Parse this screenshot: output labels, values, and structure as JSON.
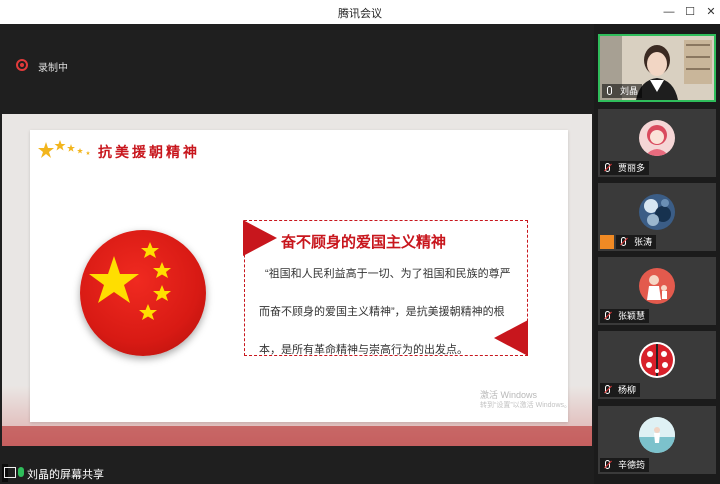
{
  "window": {
    "title": "腾讯会议",
    "minimize": "—",
    "maximize": "☐",
    "close": "✕"
  },
  "recording": {
    "label": "录制中"
  },
  "slide": {
    "heading": "抗美援朝精神",
    "quote_title": "奋不顾身的爱国主义精神",
    "quote_lines": [
      "“祖国和人民利益高于一切、为了祖国和民族的尊严",
      "而奋不顾身的爱国主义精神”，是抗美援朝精神的根",
      "本，是所有革命精神与崇高行为的出发点。"
    ],
    "watermark_line1": "激活 Windows",
    "watermark_line2": "转到“设置”以激活 Windows。"
  },
  "share": {
    "label": "刘晶的屏幕共享"
  },
  "participants": [
    {
      "name": "刘晶",
      "active": true,
      "mic": "on",
      "icon": "camera-video"
    },
    {
      "name": "贾丽多",
      "active": false,
      "mic": "muted",
      "icon": "avatar-girl-pink"
    },
    {
      "name": "张涛",
      "active": false,
      "mic": "muted",
      "icon": "avatar-blue-pattern",
      "hand": true
    },
    {
      "name": "张颖慧",
      "active": false,
      "mic": "muted",
      "icon": "avatar-girl-red"
    },
    {
      "name": "杨柳",
      "active": false,
      "mic": "muted",
      "icon": "avatar-ladybug"
    },
    {
      "name": "辛德筠",
      "active": false,
      "mic": "muted",
      "icon": "avatar-beach"
    }
  ],
  "colors": {
    "accent_red": "#c8161d",
    "active_green": "#2fbd5b",
    "record_red": "#e13b3b"
  }
}
